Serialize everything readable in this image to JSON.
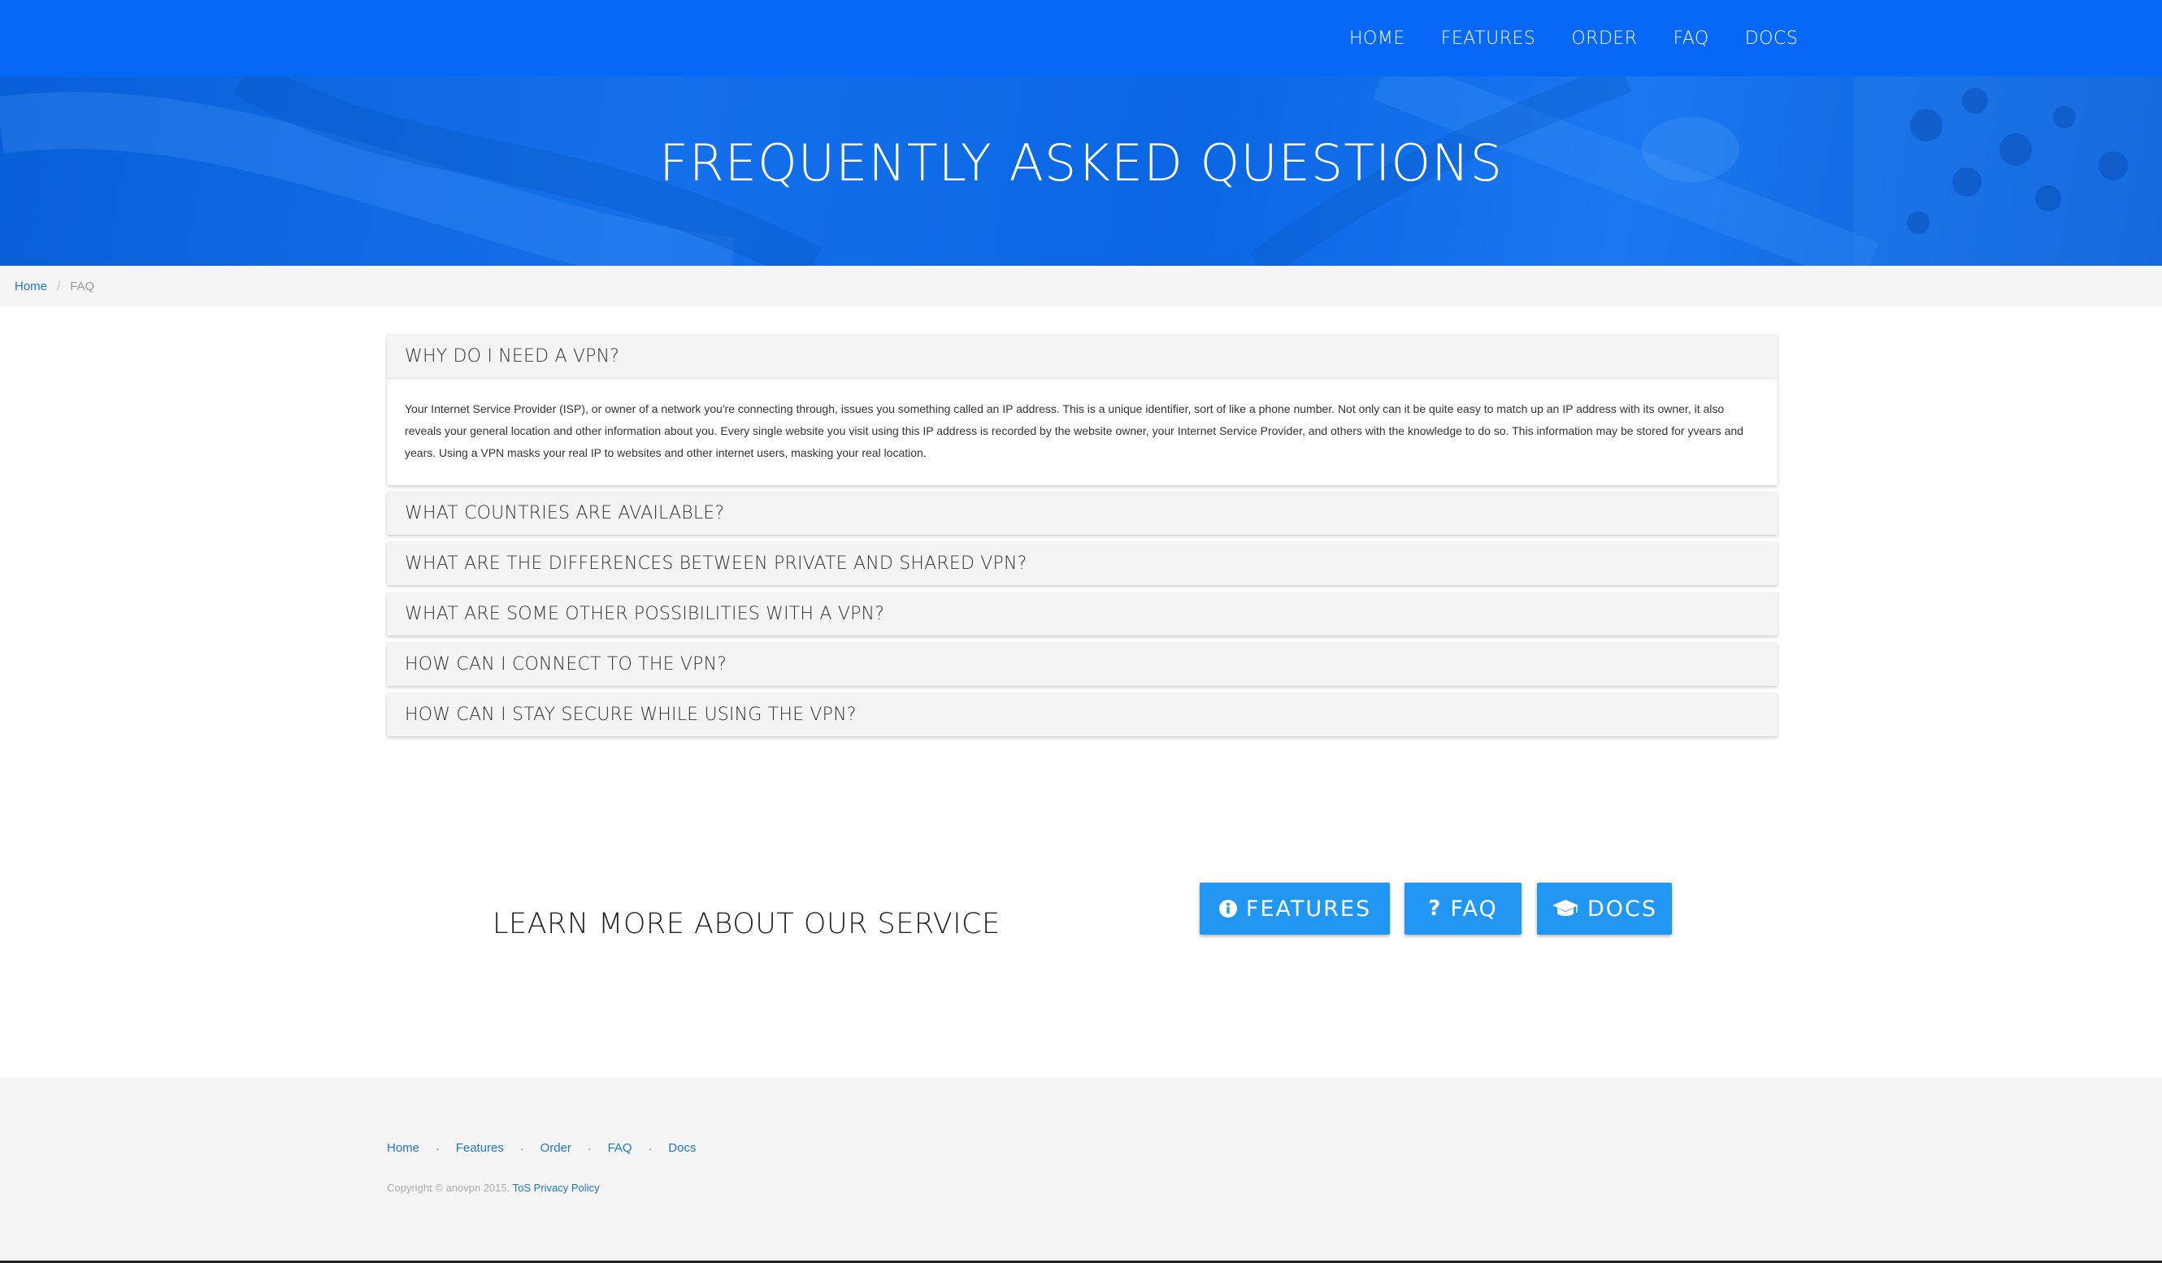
{
  "nav": {
    "items": [
      "HOME",
      "FEATURES",
      "ORDER",
      "FAQ",
      "DOCS"
    ]
  },
  "hero": {
    "title": "FREQUENTLY ASKED QUESTIONS"
  },
  "breadcrumb": {
    "home": "Home",
    "separator": "/",
    "current": "FAQ"
  },
  "faq": {
    "items": [
      {
        "question": "WHY DO I NEED A VPN?",
        "answer": "Your Internet Service Provider (ISP), or owner of a network you're connecting through, issues you something called an IP address. This is a unique identifier, sort of like a phone number. Not only can it be quite easy to match up an IP address with its owner, it also reveals your general location and other information about you. Every single website you visit using this IP address is recorded by the website owner, your Internet Service Provider, and others with the knowledge to do so. This information may be stored for yvears and years. Using a VPN masks your real IP to websites and other internet users, masking your real location.",
        "expanded": true
      },
      {
        "question": "WHAT COUNTRIES ARE AVAILABLE?",
        "expanded": false
      },
      {
        "question": "WHAT ARE THE DIFFERENCES BETWEEN PRIVATE AND SHARED VPN?",
        "expanded": false
      },
      {
        "question": "WHAT ARE SOME OTHER POSSIBILITIES WITH A VPN?",
        "expanded": false
      },
      {
        "question": "HOW CAN I CONNECT TO THE VPN?",
        "expanded": false
      },
      {
        "question": "HOW CAN I STAY SECURE WHILE USING THE VPN?",
        "expanded": false
      }
    ]
  },
  "learn_more": {
    "title": "LEARN MORE ABOUT OUR SERVICE",
    "buttons": [
      {
        "label": "FEATURES",
        "icon": "info-circle-icon"
      },
      {
        "label": "FAQ",
        "icon": "question-icon"
      },
      {
        "label": "DOCS",
        "icon": "graduation-cap-icon"
      }
    ]
  },
  "footer": {
    "links": [
      "Home",
      "Features",
      "Order",
      "FAQ",
      "Docs"
    ],
    "separator": "·",
    "copyright": "Copyright © anovpn 2015.",
    "tos": "ToS",
    "privacy": "Privacy Policy"
  },
  "colors": {
    "nav_bg": "#0767f7",
    "button_bg": "#2196f3",
    "link": "#1976d2"
  }
}
